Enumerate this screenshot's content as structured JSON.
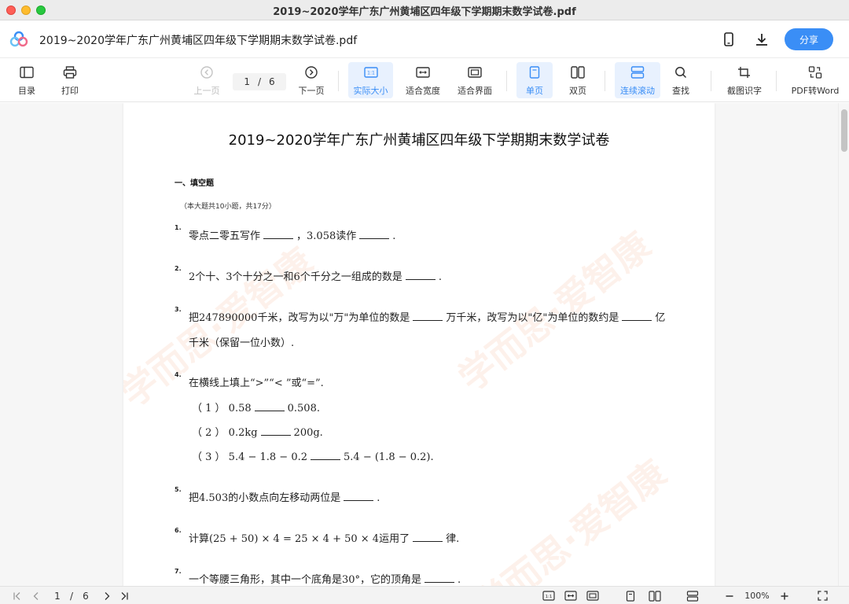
{
  "window": {
    "title": "2019~2020学年广东广州黄埔区四年级下学期期末数学试卷.pdf"
  },
  "header": {
    "doc_title": "2019~2020学年广东广州黄埔区四年级下学期期末数学试卷.pdf",
    "share_label": "分享",
    "icons": [
      "phone-icon",
      "download-icon"
    ]
  },
  "toolbar": {
    "catalog": "目录",
    "print": "打印",
    "prev_page": "上一页",
    "current_page": "1",
    "page_sep": "/",
    "total_pages": "6",
    "next_page": "下一页",
    "actual_size": "实际大小",
    "fit_width": "适合宽度",
    "fit_window": "适合界面",
    "single_page": "单页",
    "double_page": "双页",
    "continuous_scroll": "连续滚动",
    "find": "查找",
    "ocr": "截图识字",
    "pdf_to_word": "PDF转Word"
  },
  "document": {
    "title": "2019~2020学年广东广州黄埔区四年级下学期期末数学试卷",
    "section_heading": "一、填空题",
    "section_note": "（本大题共10小题，共17分）",
    "watermark": "学而思·爱智康",
    "questions": {
      "q1": {
        "num": "1.",
        "a": "零点二零五写作",
        "b": "，3.058读作",
        "c": "."
      },
      "q2": {
        "num": "2.",
        "a": "2个十、3个十分之一和6个千分之一组成的数是",
        "b": "."
      },
      "q3": {
        "num": "3.",
        "a": "把247890000千米，改写为以\"万\"为单位的数是",
        "b": "万千米，改写为以\"亿\"为单位的数约是",
        "c": "亿",
        "line2": "千米（保留一位小数）."
      },
      "q4": {
        "num": "4.",
        "text": "在横线上填上“>”“< ”或“=”.",
        "sub1_a": "（ 1 ）  0.58",
        "sub1_b": "0.508.",
        "sub2_a": "（ 2 ）  0.2kg",
        "sub2_b": "200g.",
        "sub3_a": "（ 3 ）  5.4 − 1.8 − 0.2",
        "sub3_b": "5.4 − (1.8 − 0.2)."
      },
      "q5": {
        "num": "5.",
        "a": "把4.503的小数点向左移动两位是",
        "b": "."
      },
      "q6": {
        "num": "6.",
        "a": "计算(25 + 50) × 4 = 25 × 4 + 50 × 4运用了",
        "b": "律."
      },
      "q7": {
        "num": "7.",
        "a": "一个等腰三角形，其中一个底角是30°，它的顶角是",
        "b": "."
      }
    }
  },
  "statusbar": {
    "current_page": "1",
    "page_sep": "/",
    "total_pages": "6",
    "zoom": "100%"
  },
  "colors": {
    "accent": "#3a8ef6",
    "active_bg": "#e8f1fe"
  }
}
